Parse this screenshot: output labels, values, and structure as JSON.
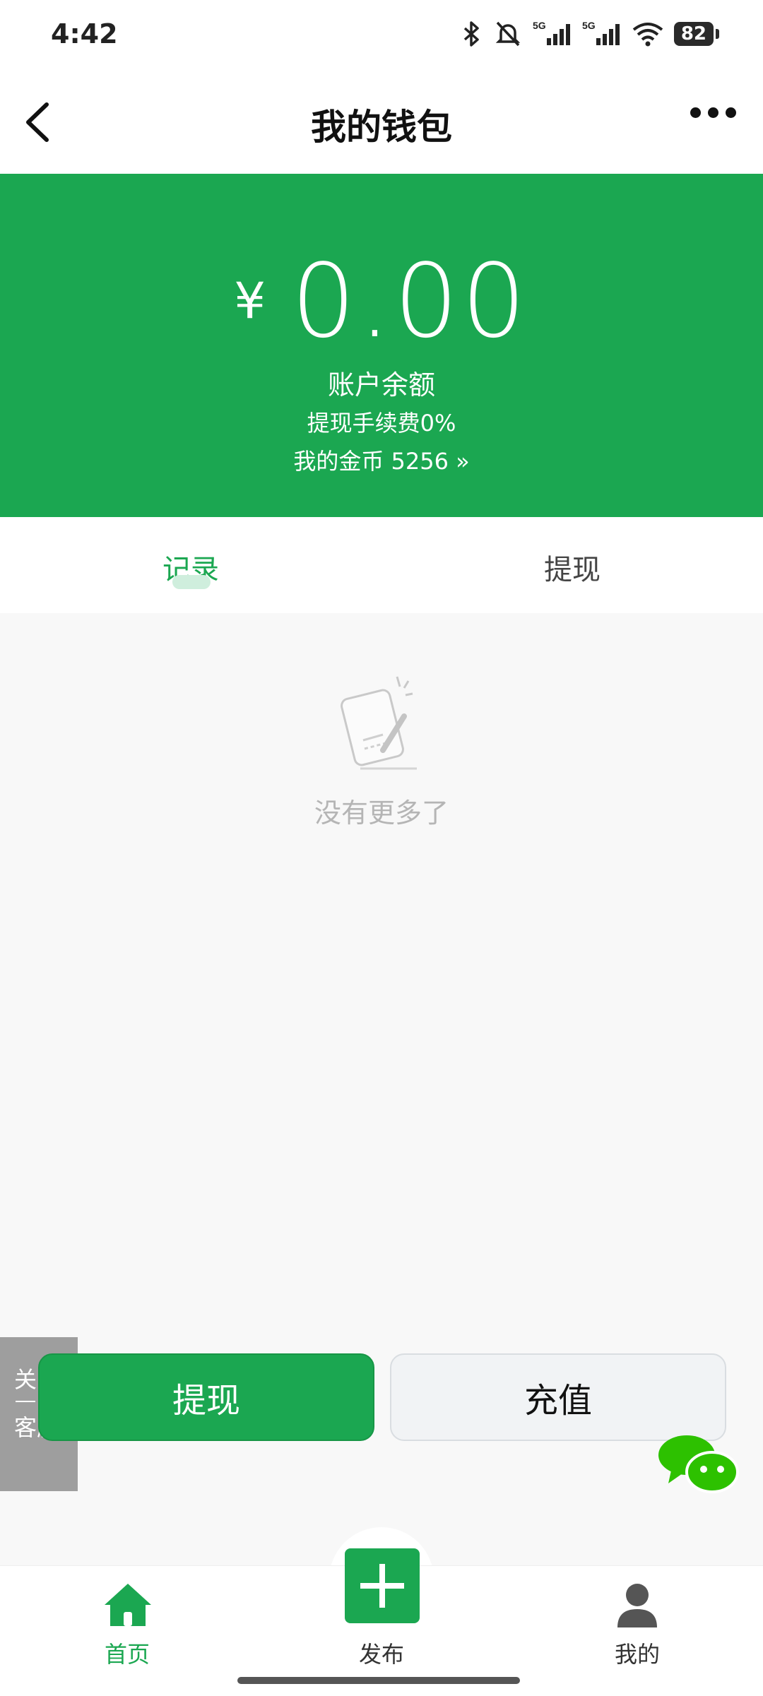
{
  "status_bar": {
    "time": "4:42",
    "battery": "82",
    "network": "5G"
  },
  "header": {
    "title": "我的钱包"
  },
  "wallet": {
    "currency_symbol": "¥",
    "amount": "0.00",
    "balance_label": "账户余额",
    "fee_text": "提现手续费0%",
    "coins_text": "我的金币 5256 »"
  },
  "tabs": [
    {
      "label": "记录",
      "active": true
    },
    {
      "label": "提现",
      "active": false
    }
  ],
  "empty_state": {
    "text": "没有更多了"
  },
  "actions": {
    "withdraw_label": "提现",
    "recharge_label": "充值"
  },
  "service": {
    "close_label": "关",
    "service_label": "客服"
  },
  "bottom_nav": [
    {
      "label": "首页",
      "icon": "home-icon",
      "active": true
    },
    {
      "label": "发布",
      "icon": "plus-icon",
      "active": false
    },
    {
      "label": "我的",
      "icon": "user-icon",
      "active": false
    }
  ],
  "colors": {
    "brand": "#1ba751",
    "service": "#9e9e9e"
  }
}
